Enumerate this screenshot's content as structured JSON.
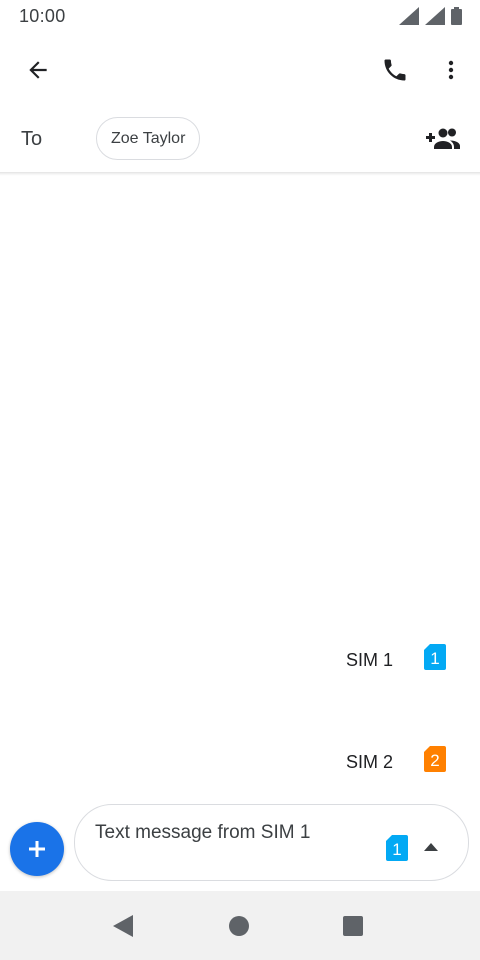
{
  "status_bar": {
    "time": "10:00",
    "icons": [
      "signal-icon",
      "signal-icon",
      "battery-icon"
    ]
  },
  "app_bar": {
    "icons": [
      "back-arrow-icon",
      "phone-icon",
      "more-vert-icon"
    ]
  },
  "recipients": {
    "to_label": "To",
    "chips": [
      "Zoe Taylor"
    ],
    "add_icon": "add-people-icon"
  },
  "sim_picker": {
    "options": [
      {
        "label": "SIM 1",
        "badge": "1",
        "color": "#03a9f4"
      },
      {
        "label": "SIM 2",
        "badge": "2",
        "color": "#ff8000"
      }
    ]
  },
  "compose": {
    "placeholder": "Text message from SIM 1",
    "sim_badge": "1",
    "sim_color": "#03a9f4",
    "fab_color": "#1a73e8",
    "icons": [
      "add-icon",
      "caret-up-icon"
    ]
  },
  "nav_bar": {
    "icons": [
      "nav-back-icon",
      "nav-home-icon",
      "nav-recents-icon"
    ]
  }
}
